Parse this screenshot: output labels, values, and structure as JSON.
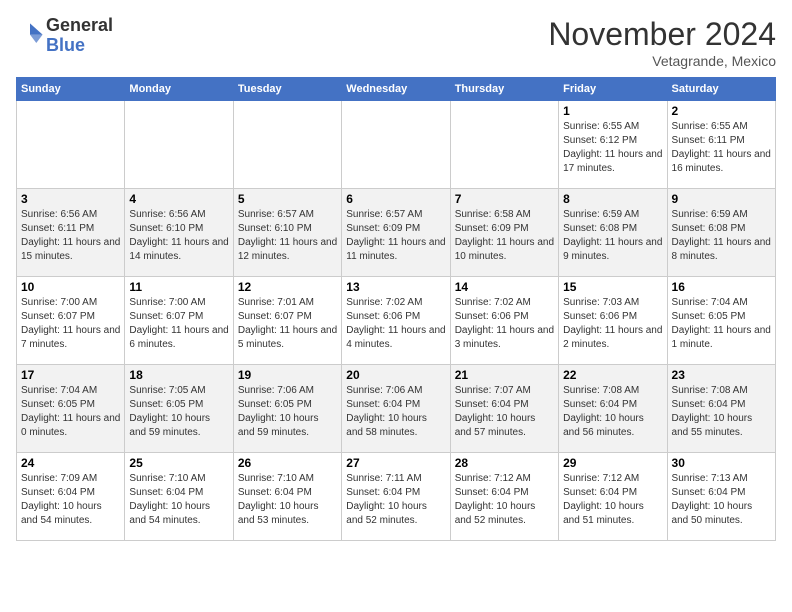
{
  "header": {
    "logo_line1": "General",
    "logo_line2": "Blue",
    "month_title": "November 2024",
    "subtitle": "Vetagrande, Mexico"
  },
  "days_of_week": [
    "Sunday",
    "Monday",
    "Tuesday",
    "Wednesday",
    "Thursday",
    "Friday",
    "Saturday"
  ],
  "weeks": [
    {
      "days": [
        {
          "num": "",
          "info": ""
        },
        {
          "num": "",
          "info": ""
        },
        {
          "num": "",
          "info": ""
        },
        {
          "num": "",
          "info": ""
        },
        {
          "num": "",
          "info": ""
        },
        {
          "num": "1",
          "info": "Sunrise: 6:55 AM\nSunset: 6:12 PM\nDaylight: 11 hours and 17 minutes."
        },
        {
          "num": "2",
          "info": "Sunrise: 6:55 AM\nSunset: 6:11 PM\nDaylight: 11 hours and 16 minutes."
        }
      ]
    },
    {
      "days": [
        {
          "num": "3",
          "info": "Sunrise: 6:56 AM\nSunset: 6:11 PM\nDaylight: 11 hours and 15 minutes."
        },
        {
          "num": "4",
          "info": "Sunrise: 6:56 AM\nSunset: 6:10 PM\nDaylight: 11 hours and 14 minutes."
        },
        {
          "num": "5",
          "info": "Sunrise: 6:57 AM\nSunset: 6:10 PM\nDaylight: 11 hours and 12 minutes."
        },
        {
          "num": "6",
          "info": "Sunrise: 6:57 AM\nSunset: 6:09 PM\nDaylight: 11 hours and 11 minutes."
        },
        {
          "num": "7",
          "info": "Sunrise: 6:58 AM\nSunset: 6:09 PM\nDaylight: 11 hours and 10 minutes."
        },
        {
          "num": "8",
          "info": "Sunrise: 6:59 AM\nSunset: 6:08 PM\nDaylight: 11 hours and 9 minutes."
        },
        {
          "num": "9",
          "info": "Sunrise: 6:59 AM\nSunset: 6:08 PM\nDaylight: 11 hours and 8 minutes."
        }
      ]
    },
    {
      "days": [
        {
          "num": "10",
          "info": "Sunrise: 7:00 AM\nSunset: 6:07 PM\nDaylight: 11 hours and 7 minutes."
        },
        {
          "num": "11",
          "info": "Sunrise: 7:00 AM\nSunset: 6:07 PM\nDaylight: 11 hours and 6 minutes."
        },
        {
          "num": "12",
          "info": "Sunrise: 7:01 AM\nSunset: 6:07 PM\nDaylight: 11 hours and 5 minutes."
        },
        {
          "num": "13",
          "info": "Sunrise: 7:02 AM\nSunset: 6:06 PM\nDaylight: 11 hours and 4 minutes."
        },
        {
          "num": "14",
          "info": "Sunrise: 7:02 AM\nSunset: 6:06 PM\nDaylight: 11 hours and 3 minutes."
        },
        {
          "num": "15",
          "info": "Sunrise: 7:03 AM\nSunset: 6:06 PM\nDaylight: 11 hours and 2 minutes."
        },
        {
          "num": "16",
          "info": "Sunrise: 7:04 AM\nSunset: 6:05 PM\nDaylight: 11 hours and 1 minute."
        }
      ]
    },
    {
      "days": [
        {
          "num": "17",
          "info": "Sunrise: 7:04 AM\nSunset: 6:05 PM\nDaylight: 11 hours and 0 minutes."
        },
        {
          "num": "18",
          "info": "Sunrise: 7:05 AM\nSunset: 6:05 PM\nDaylight: 10 hours and 59 minutes."
        },
        {
          "num": "19",
          "info": "Sunrise: 7:06 AM\nSunset: 6:05 PM\nDaylight: 10 hours and 59 minutes."
        },
        {
          "num": "20",
          "info": "Sunrise: 7:06 AM\nSunset: 6:04 PM\nDaylight: 10 hours and 58 minutes."
        },
        {
          "num": "21",
          "info": "Sunrise: 7:07 AM\nSunset: 6:04 PM\nDaylight: 10 hours and 57 minutes."
        },
        {
          "num": "22",
          "info": "Sunrise: 7:08 AM\nSunset: 6:04 PM\nDaylight: 10 hours and 56 minutes."
        },
        {
          "num": "23",
          "info": "Sunrise: 7:08 AM\nSunset: 6:04 PM\nDaylight: 10 hours and 55 minutes."
        }
      ]
    },
    {
      "days": [
        {
          "num": "24",
          "info": "Sunrise: 7:09 AM\nSunset: 6:04 PM\nDaylight: 10 hours and 54 minutes."
        },
        {
          "num": "25",
          "info": "Sunrise: 7:10 AM\nSunset: 6:04 PM\nDaylight: 10 hours and 54 minutes."
        },
        {
          "num": "26",
          "info": "Sunrise: 7:10 AM\nSunset: 6:04 PM\nDaylight: 10 hours and 53 minutes."
        },
        {
          "num": "27",
          "info": "Sunrise: 7:11 AM\nSunset: 6:04 PM\nDaylight: 10 hours and 52 minutes."
        },
        {
          "num": "28",
          "info": "Sunrise: 7:12 AM\nSunset: 6:04 PM\nDaylight: 10 hours and 52 minutes."
        },
        {
          "num": "29",
          "info": "Sunrise: 7:12 AM\nSunset: 6:04 PM\nDaylight: 10 hours and 51 minutes."
        },
        {
          "num": "30",
          "info": "Sunrise: 7:13 AM\nSunset: 6:04 PM\nDaylight: 10 hours and 50 minutes."
        }
      ]
    }
  ]
}
